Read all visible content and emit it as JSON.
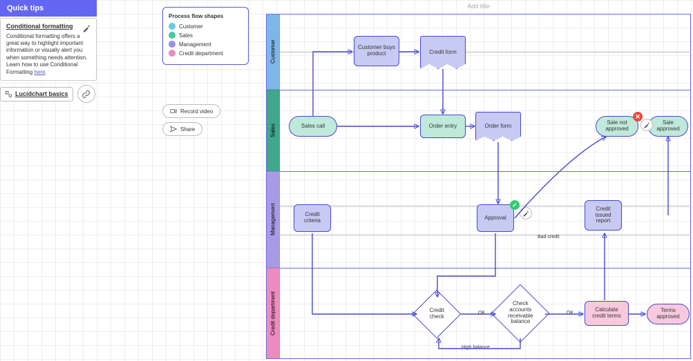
{
  "tips": {
    "header": "Quick tips",
    "card_title": "Conditional formatting",
    "card_body": "Conditional formatting offers a great way to highlight important information or visually alert you when something needs attention. Learn how to use Conditional Formatting ",
    "card_link": "here",
    "basics_label": "Lucidchart basics"
  },
  "legend": {
    "title": "Process flow shapes",
    "items": [
      {
        "label": "Customer",
        "color": "#6fc8e8"
      },
      {
        "label": "Sales",
        "color": "#49c8a3"
      },
      {
        "label": "Management",
        "color": "#9a8ee8"
      },
      {
        "label": "Credit department",
        "color": "#ec8bc0"
      }
    ]
  },
  "actions": {
    "record": "Record video",
    "share": "Share"
  },
  "frame": {
    "title_placeholder": "Add title",
    "lanes": [
      {
        "name": "Customer",
        "color": "#6fc8e8"
      },
      {
        "name": "Sales",
        "color": "#49c8a3"
      },
      {
        "name": "Management",
        "color": "#9a8ee8"
      },
      {
        "name": "Credit department",
        "color": "#ec8bc0"
      }
    ]
  },
  "nodes": {
    "sales_call": "Sales call",
    "cust_buys": "Customer buys product",
    "credit_form": "Credit form",
    "order_entry": "Order entry",
    "order_form": "Order form",
    "sale_not_appr": "Sale not approved",
    "sale_approved": "Sale approved",
    "credit_criteria": "Credit criteria",
    "approval": "Approval",
    "credit_issued": "Credit issued report",
    "credit_check": "Credit check",
    "check_balance": "Check accounts receivable balance",
    "calc_terms": "Calculate credit terms",
    "terms_approved": "Terms approved"
  },
  "edge_labels": {
    "ok1": "OK",
    "ok2": "OK",
    "bad_credit": "Bad credit",
    "high_balance": "High balance"
  },
  "chart_data": {
    "type": "swimlane-flowchart",
    "title": "",
    "lanes": [
      "Customer",
      "Sales",
      "Management",
      "Credit department"
    ],
    "nodes": [
      {
        "id": "sales_call",
        "lane": "Sales",
        "type": "terminator",
        "label": "Sales call"
      },
      {
        "id": "cust_buys",
        "lane": "Customer",
        "type": "process",
        "label": "Customer buys product"
      },
      {
        "id": "credit_form",
        "lane": "Customer",
        "type": "document",
        "label": "Credit form"
      },
      {
        "id": "order_entry",
        "lane": "Sales",
        "type": "process",
        "label": "Order entry"
      },
      {
        "id": "order_form",
        "lane": "Sales",
        "type": "document",
        "label": "Order form"
      },
      {
        "id": "sale_not_appr",
        "lane": "Sales",
        "type": "terminator",
        "label": "Sale not approved"
      },
      {
        "id": "sale_approved",
        "lane": "Sales",
        "type": "terminator",
        "label": "Sale approved"
      },
      {
        "id": "credit_criteria",
        "lane": "Management",
        "type": "process",
        "label": "Credit criteria"
      },
      {
        "id": "approval",
        "lane": "Management",
        "type": "process",
        "label": "Approval"
      },
      {
        "id": "credit_issued",
        "lane": "Management",
        "type": "process",
        "label": "Credit issued report"
      },
      {
        "id": "credit_check",
        "lane": "Credit department",
        "type": "decision",
        "label": "Credit check"
      },
      {
        "id": "check_balance",
        "lane": "Credit department",
        "type": "decision",
        "label": "Check accounts receivable balance"
      },
      {
        "id": "calc_terms",
        "lane": "Credit department",
        "type": "process",
        "label": "Calculate credit terms"
      },
      {
        "id": "terms_approved",
        "lane": "Credit department",
        "type": "terminator",
        "label": "Terms approved"
      }
    ],
    "edges": [
      {
        "from": "sales_call",
        "to": "cust_buys"
      },
      {
        "from": "cust_buys",
        "to": "credit_form"
      },
      {
        "from": "credit_form",
        "to": "order_entry"
      },
      {
        "from": "sales_call",
        "to": "order_entry"
      },
      {
        "from": "order_entry",
        "to": "order_form"
      },
      {
        "from": "order_form",
        "to": "approval"
      },
      {
        "from": "credit_criteria",
        "to": "credit_check"
      },
      {
        "from": "approval",
        "to": "credit_check"
      },
      {
        "from": "approval",
        "to": "sale_not_appr",
        "label": "Bad credit"
      },
      {
        "from": "credit_check",
        "to": "check_balance",
        "label": "OK"
      },
      {
        "from": "check_balance",
        "to": "calc_terms",
        "label": "OK"
      },
      {
        "from": "check_balance",
        "to": "sale_not_appr",
        "label": "High balance"
      },
      {
        "from": "calc_terms",
        "to": "terms_approved"
      },
      {
        "from": "calc_terms",
        "to": "credit_issued"
      },
      {
        "from": "credit_issued",
        "to": "sale_approved"
      }
    ]
  }
}
